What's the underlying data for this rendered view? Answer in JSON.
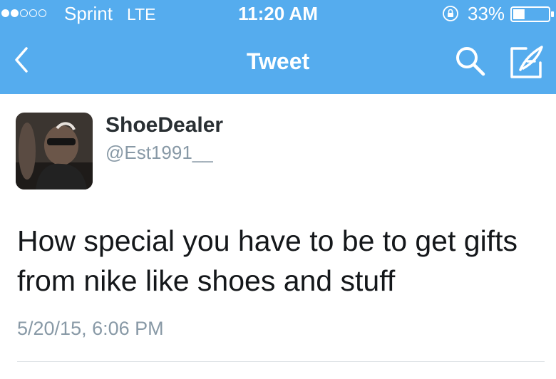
{
  "status_bar": {
    "carrier": "Sprint",
    "network": "LTE",
    "time": "11:20 AM",
    "battery_percent": "33%",
    "battery_level": 0.33,
    "signal_filled": 2,
    "signal_total": 5
  },
  "nav": {
    "back_icon": "chevron-left-icon",
    "title": "Tweet",
    "search_icon": "search-icon",
    "compose_icon": "compose-tweet-icon"
  },
  "tweet": {
    "display_name": "ShoeDealer",
    "username": "@Est1991__",
    "text": "How special you have to be to get gifts from nike like shoes and stuff",
    "timestamp": "5/20/15, 6:06 PM"
  },
  "colors": {
    "header": "#55acee",
    "name": "#292f33",
    "meta": "#8899a6",
    "text": "#14171a",
    "divider": "#dfe3e6"
  }
}
